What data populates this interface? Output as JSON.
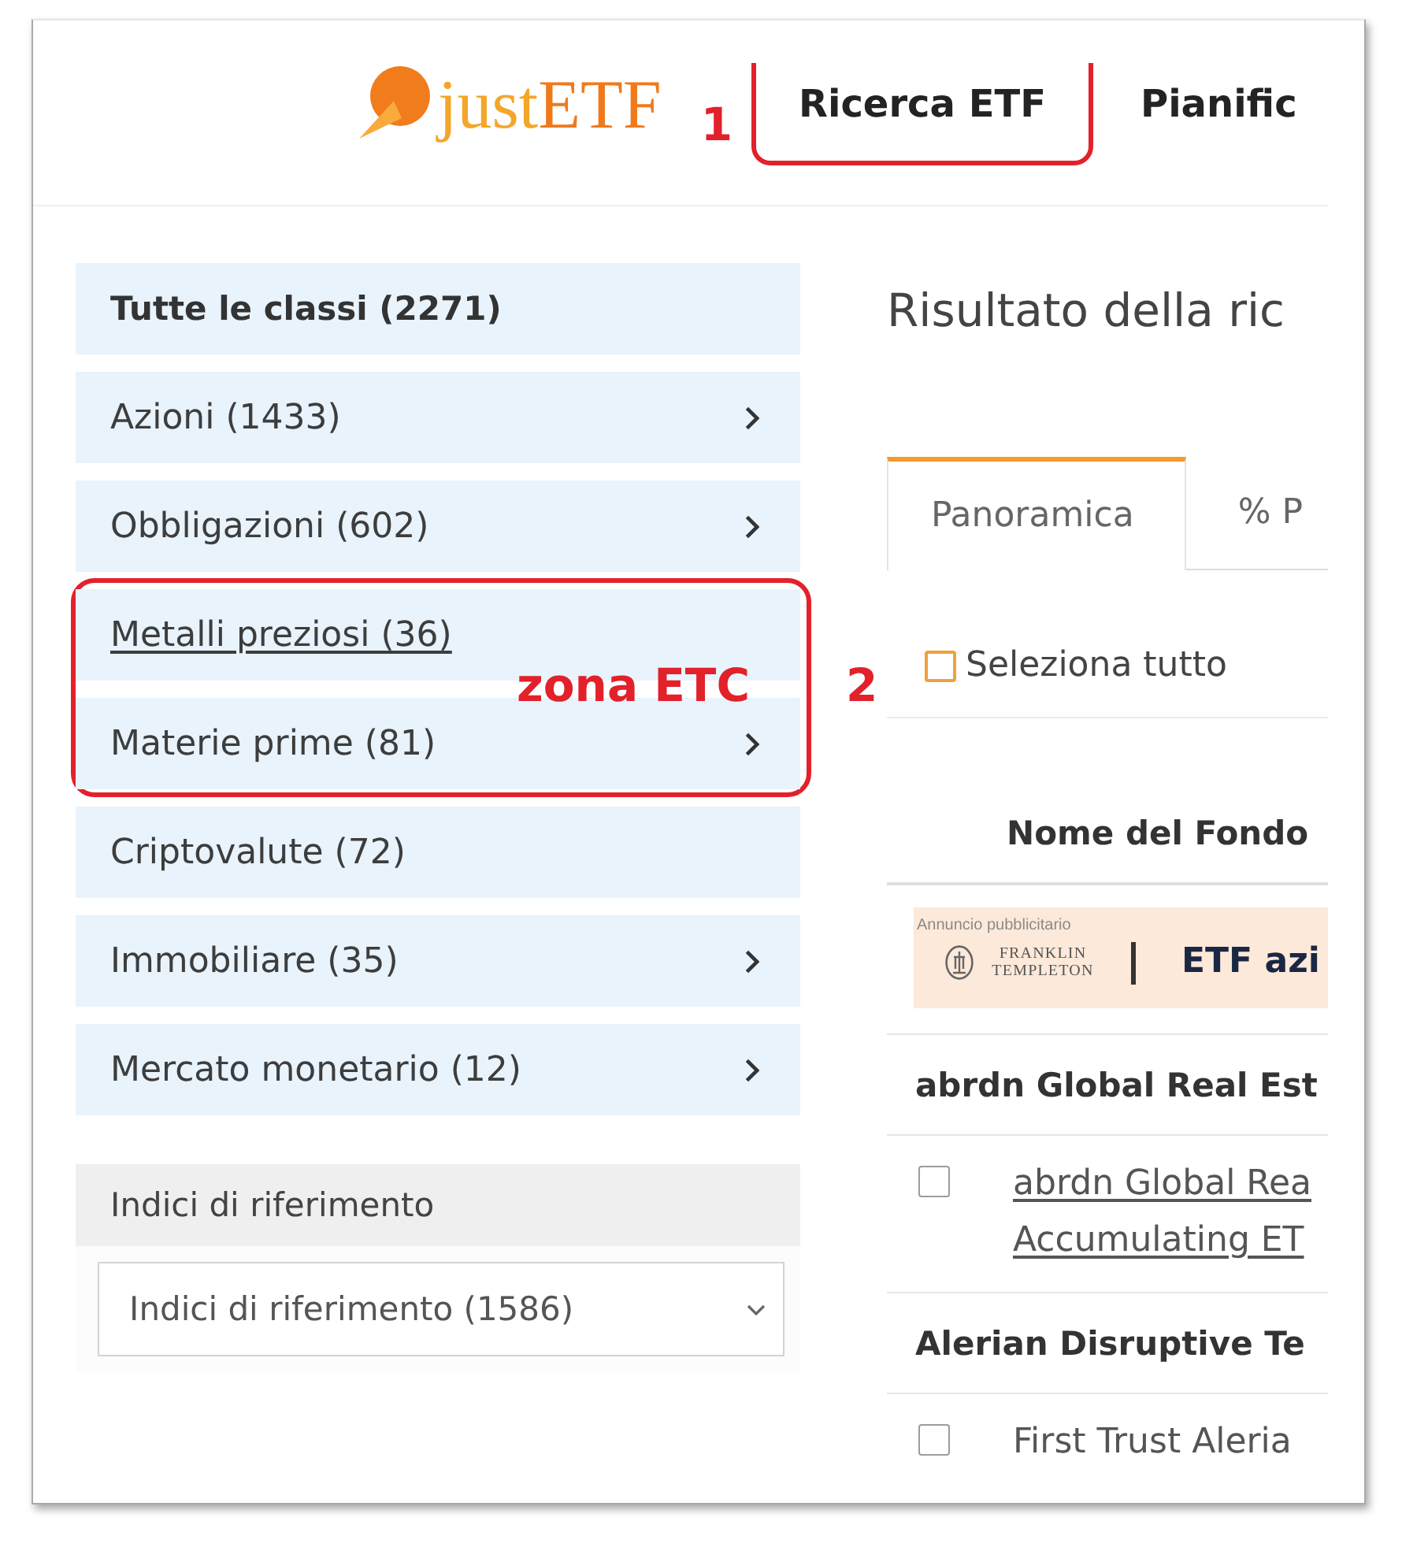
{
  "header": {
    "logo": {
      "wordmark": [
        "just",
        "ETF"
      ]
    },
    "nav": [
      {
        "label": "Ricerca ETF",
        "annotation": "1"
      },
      {
        "label": "Pianific"
      }
    ]
  },
  "sidebar": {
    "asset_classes": [
      {
        "kind": "item",
        "label": "Tutte le classi (2271)",
        "selected": true,
        "underlined": false,
        "has_submenu": false
      },
      {
        "kind": "item",
        "label": "Azioni (1433)",
        "selected": false,
        "underlined": false,
        "has_submenu": true
      },
      {
        "kind": "item",
        "label": "Obbligazioni (602)",
        "selected": false,
        "underlined": false,
        "has_submenu": true
      },
      {
        "kind": "annotated_group",
        "annotation": {
          "label": "zona ETC",
          "number": "2"
        },
        "items": [
          {
            "label": "Metalli preziosi (36)",
            "selected": false,
            "underlined": true,
            "has_submenu": false
          },
          {
            "label": "Materie prime (81)",
            "selected": false,
            "underlined": false,
            "has_submenu": true
          }
        ]
      },
      {
        "kind": "item",
        "label": "Criptovalute (72)",
        "selected": false,
        "underlined": false,
        "has_submenu": false
      },
      {
        "kind": "item",
        "label": "Immobiliare (35)",
        "selected": false,
        "underlined": false,
        "has_submenu": true
      },
      {
        "kind": "item",
        "label": "Mercato monetario (12)",
        "selected": false,
        "underlined": false,
        "has_submenu": true
      }
    ],
    "benchmark_filter": {
      "title": "Indici di riferimento",
      "value": "Indici di riferimento (1586)"
    }
  },
  "results": {
    "title": "Risultato della ric",
    "tabs": [
      {
        "label": "Panoramica",
        "selected": true
      },
      {
        "label": "% P",
        "selected": false
      }
    ],
    "select_all": {
      "label": "Seleziona tutto",
      "checked": false
    },
    "table": {
      "columns": [
        "Nome del Fondo"
      ],
      "ad": {
        "caption": "Annuncio pubblicitario",
        "advertiser": "FRANKLIN TEMPLETON",
        "headline": "ETF azi"
      },
      "rows": [
        {
          "kind": "group",
          "label": "abrdn Global Real Est"
        },
        {
          "kind": "fund",
          "name_lines": [
            "abrdn Global Rea",
            "Accumulating ET"
          ],
          "checked": false,
          "underlined": true
        },
        {
          "kind": "group",
          "label": "Alerian Disruptive Te"
        },
        {
          "kind": "fund",
          "name_lines": [
            "First Trust Aleria"
          ],
          "checked": false,
          "underlined": false
        }
      ]
    }
  }
}
